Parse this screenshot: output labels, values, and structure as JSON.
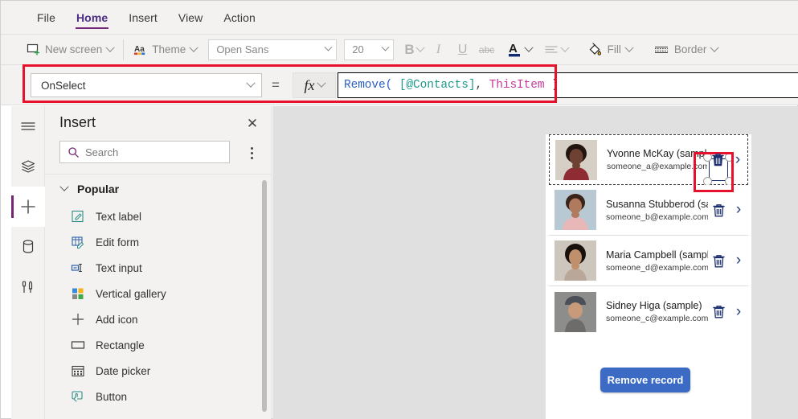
{
  "menubar": {
    "items": [
      {
        "label": "File",
        "active": false
      },
      {
        "label": "Home",
        "active": true
      },
      {
        "label": "Insert",
        "active": false
      },
      {
        "label": "View",
        "active": false
      },
      {
        "label": "Action",
        "active": false
      }
    ]
  },
  "toolbar": {
    "new_screen_label": "New screen",
    "theme_label": "Theme",
    "font_name": "Open Sans",
    "font_size": "20",
    "bold_label": "B",
    "italic_label": "I",
    "underline_label": "U",
    "strikethrough_label": "abc",
    "font_color_label": "A",
    "fill_label": "Fill",
    "border_label": "Border",
    "icons": {
      "new_screen": "new-screen-icon",
      "theme": "theme-aa-icon",
      "align": "align-text-icon",
      "fill": "paint-bucket-icon",
      "border": "border-icon"
    }
  },
  "formula_bar": {
    "property": "OnSelect",
    "equals": "=",
    "fx_label": "fx",
    "formula_tokens": [
      {
        "text": "Remove(",
        "type": "fn"
      },
      {
        "text": " ",
        "type": "pun"
      },
      {
        "text": "[@Contacts]",
        "type": "tbl"
      },
      {
        "text": ", ",
        "type": "pun"
      },
      {
        "text": "ThisItem",
        "type": "self"
      },
      {
        "text": " )",
        "type": "pun"
      }
    ],
    "formula_text": "Remove( [@Contacts], ThisItem )",
    "highlight_color": "#e8112d"
  },
  "rail": {
    "items": [
      {
        "icon": "hamburger-menu-icon",
        "active": false
      },
      {
        "icon": "tree-view-layers-icon",
        "active": false
      },
      {
        "icon": "insert-plus-icon",
        "active": true
      },
      {
        "icon": "data-cylinder-icon",
        "active": false
      },
      {
        "icon": "media-tools-icon",
        "active": false
      }
    ]
  },
  "insert_panel": {
    "title": "Insert",
    "close_label": "✕",
    "search_placeholder": "Search",
    "group_label": "Popular",
    "items": [
      {
        "label": "Text label",
        "icon": "text-label-icon"
      },
      {
        "label": "Edit form",
        "icon": "edit-form-icon"
      },
      {
        "label": "Text input",
        "icon": "text-input-icon"
      },
      {
        "label": "Vertical gallery",
        "icon": "vertical-gallery-icon"
      },
      {
        "label": "Add icon",
        "icon": "add-plus-icon"
      },
      {
        "label": "Rectangle",
        "icon": "rectangle-icon"
      },
      {
        "label": "Date picker",
        "icon": "calendar-icon"
      },
      {
        "label": "Button",
        "icon": "button-icon"
      }
    ]
  },
  "canvas": {
    "gallery": {
      "items": [
        {
          "name": "Yvonne McKay (sample)",
          "email": "someone_a@example.com",
          "selected": true,
          "skin": "#6d4232",
          "hair": "#22150f",
          "bg": "#d6cfc6"
        },
        {
          "name": "Susanna Stubberod (sample)",
          "email": "someone_b@example.com",
          "selected": false,
          "skin": "#b07a5e",
          "hair": "#3a2318",
          "bg": "#b8c9d4"
        },
        {
          "name": "Maria Campbell (sample)",
          "email": "someone_d@example.com",
          "selected": false,
          "skin": "#c08f6c",
          "hair": "#17100c",
          "bg": "#ccc6bd"
        },
        {
          "name": "Sidney Higa (sample)",
          "email": "someone_c@example.com",
          "selected": false,
          "skin": "#c79a79",
          "hair": "#4b4f58",
          "bg": "#8d8d8c"
        }
      ],
      "trash_icon": "delete-trash-icon",
      "arrow_icon": "chevron-right-icon"
    },
    "remove_record_button": {
      "label": "Remove record",
      "color": "#3b6bc4"
    }
  }
}
